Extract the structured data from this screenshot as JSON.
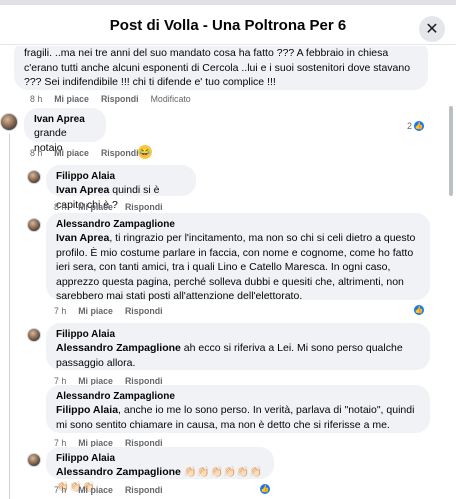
{
  "header": {
    "title": "Post di Volla - Una Poltrona Per 6",
    "close_icon": "close-icon"
  },
  "actions_labels": {
    "like": "Mi piace",
    "reply": "Rispondi",
    "modified": "Modificato"
  },
  "comments": [
    {
      "text": "fragili. ..ma nei tre anni del suo mandato cosa ha fatto ??? A febbraio in chiesa c'erano tutti anche alcuni esponenti di Cercola ..lui e i suoi sostenitori dove stavano ??? Sei indifendibile !!! chi ti difende e' tuo complice !!!",
      "time": "8 h",
      "reaction_count": "2"
    },
    {
      "author": "Ivan Aprea",
      "text": "grande notaio",
      "time": "8 h"
    },
    {
      "author": "Filippo Alaia",
      "mention": "Ivan Aprea",
      "text": " quindi si è capito chi è ?",
      "time": "8 h"
    },
    {
      "author": "Alessandro Zampaglione",
      "mention": "Ivan Aprea",
      "text": ", ti ringrazio per l'incitamento, ma non so chi si celi dietro a questo profilo. È mio costume parlare in faccia, con nome e cognome, come ho fatto ieri sera, con tanti amici, tra i quali Lino e Catello Maresca. In ogni caso, apprezzo questa pagina, perché solleva dubbi e quesiti che, altrimenti, non sarebbero mai stati posti all'attenzione dell'elettorato.",
      "time": "7 h"
    },
    {
      "author": "Filippo Alaia",
      "mention": "Alessandro Zampaglione",
      "text": " ah ecco si riferiva a Lei. Mi sono perso qualche passaggio allora.",
      "time": "7 h"
    },
    {
      "author": "Alessandro Zampaglione",
      "mention": "Filippo Alaia",
      "text": ", anche io me lo sono perso. In verità, parlava di \"notaio\", quindi mi sono sentito chiamare in causa, ma non è detto che si riferisse a me.",
      "time": "7 h"
    },
    {
      "author": "Filippo Alaia",
      "mention": "Alessandro Zampaglione",
      "text": " 👏🏻👏🏻👏🏻👏🏻👏🏻👏🏻👏🏻👏🏻👏🏻",
      "time": "7 h"
    }
  ]
}
